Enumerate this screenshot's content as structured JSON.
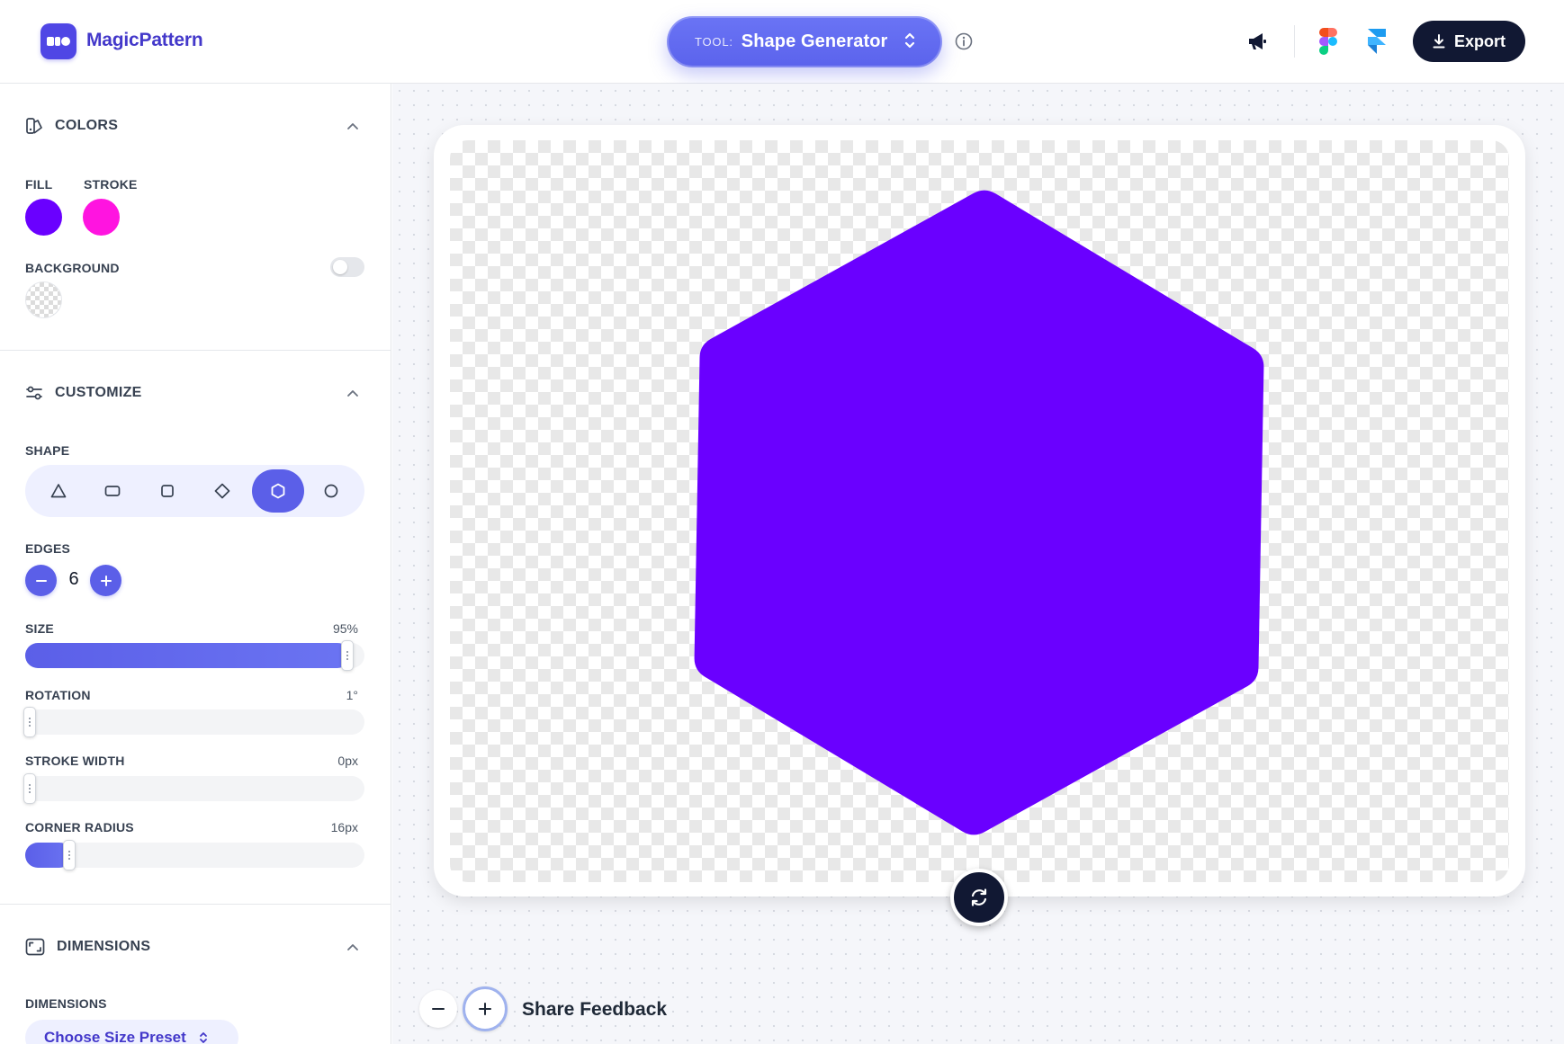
{
  "header": {
    "brand": "MagicPattern",
    "tool_prefix": "TOOL:",
    "tool_name": "Shape Generator",
    "export_label": "Export"
  },
  "colors_section": {
    "title": "COLORS",
    "fill_label": "FILL",
    "stroke_label": "STROKE",
    "background_label": "BACKGROUND",
    "fill_color": "#6a00ff",
    "stroke_color": "#ff14e0",
    "background_enabled": false
  },
  "customize_section": {
    "title": "CUSTOMIZE",
    "shape_label": "SHAPE",
    "shapes": [
      "triangle",
      "rectangle",
      "square",
      "diamond",
      "polygon",
      "circle"
    ],
    "selected_shape": "polygon",
    "edges_label": "EDGES",
    "edges_value": "6",
    "size_label": "SIZE",
    "size_value": "95%",
    "size_fraction": 0.95,
    "rotation_label": "ROTATION",
    "rotation_value": "1°",
    "rotation_fraction": 0.003,
    "stroke_width_label": "STROKE WIDTH",
    "stroke_width_value": "0px",
    "stroke_width_fraction": 0,
    "corner_radius_label": "CORNER RADIUS",
    "corner_radius_value": "16px",
    "corner_radius_fraction": 0.13
  },
  "dimensions_section": {
    "title": "DIMENSIONS",
    "dimensions_label": "DIMENSIONS",
    "preset_label": "Choose Size Preset"
  },
  "canvas": {
    "shape_color": "#6a00ff",
    "shape_edges": 6,
    "shape_rotation_deg": 1
  },
  "footer": {
    "feedback_label": "Share Feedback"
  },
  "theme": {
    "accent": "#5b5fe8",
    "dark": "#111833",
    "brand_text": "#4338ca"
  }
}
